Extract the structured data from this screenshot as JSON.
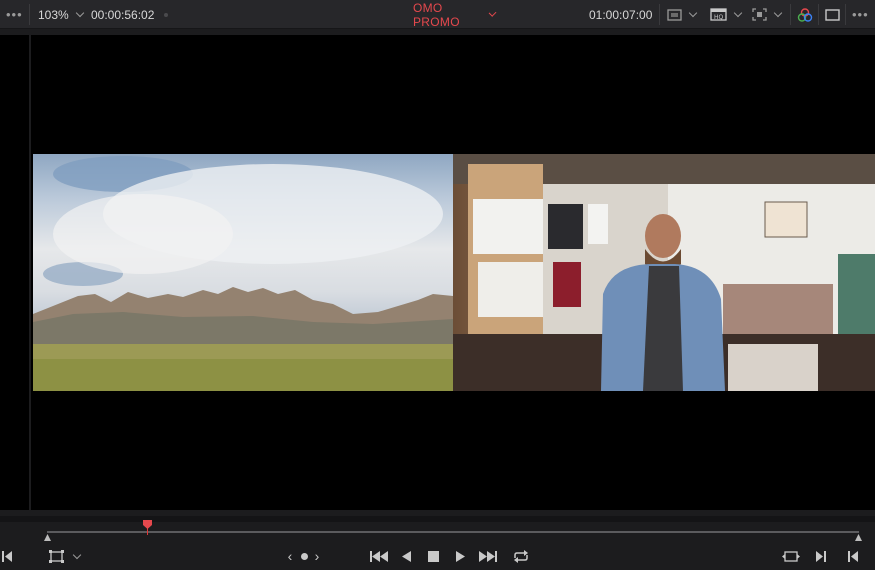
{
  "toolbar": {
    "menu_left_label": "•••",
    "zoom": "103%",
    "source_timecode": "00:00:56:02",
    "timeline_name": "OMO PROMO",
    "record_timecode": "01:00:07:00",
    "menu_right_label": "•••"
  },
  "transport": {
    "nav_prev": "‹",
    "nav_next": "›"
  },
  "playhead": {
    "position_fraction": 0.124
  },
  "colors": {
    "accent": "#e5484d",
    "toolbar_bg": "#27272a",
    "viewer_bg": "#000000"
  },
  "icons": [
    "clip-view-icon",
    "hq-icon",
    "overlay-icon",
    "color-wheel-icon",
    "window-icon",
    "transform-icon",
    "play-reverse-icon",
    "stop-icon",
    "play-icon",
    "skip-back-icon",
    "skip-forward-icon",
    "loop-icon",
    "match-frame-icon",
    "next-frame-icon",
    "prev-clip-icon",
    "first-frame-icon"
  ]
}
